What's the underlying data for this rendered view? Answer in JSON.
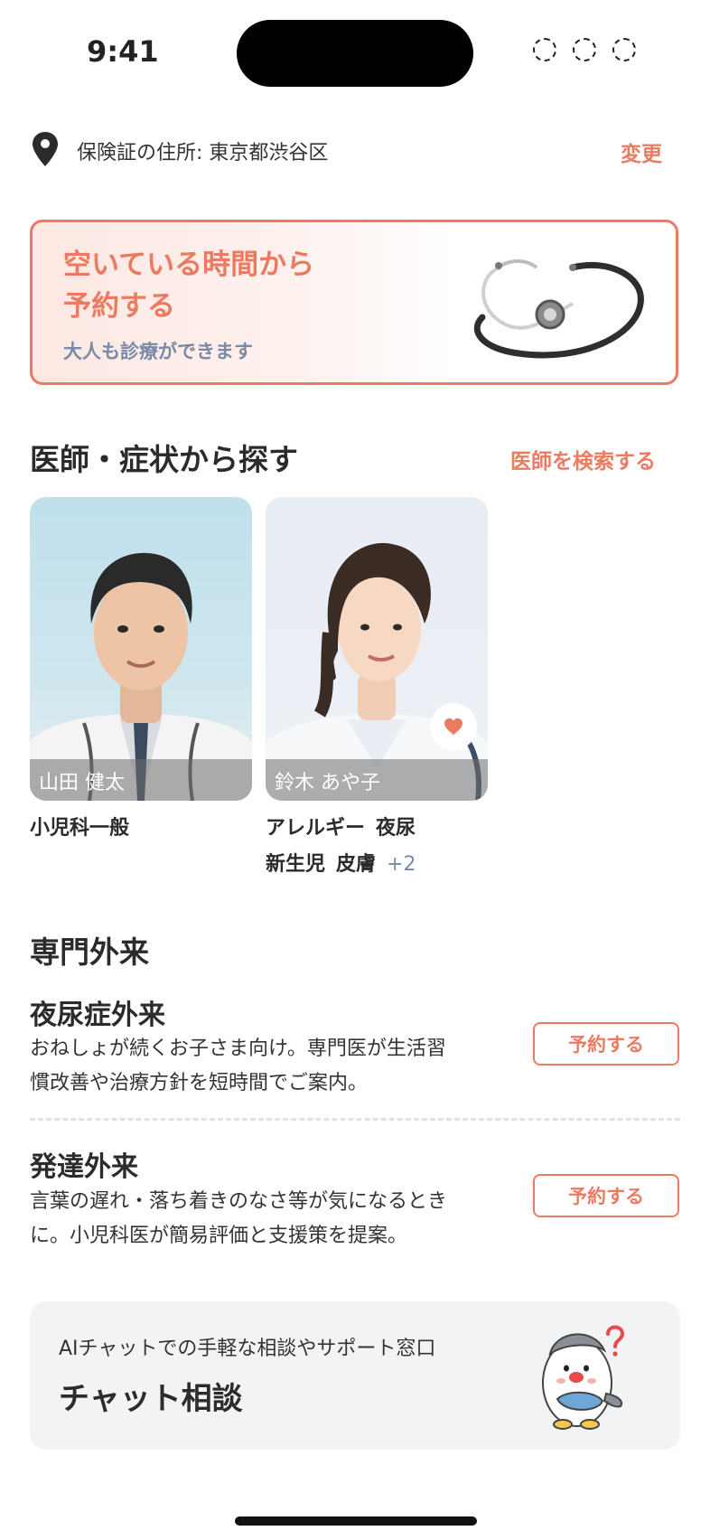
{
  "status_bar": {
    "time": "9:41"
  },
  "address": {
    "label": "保険証の住所: 東京都渋谷区",
    "change_label": "変更"
  },
  "banner": {
    "title_line1": "空いている時間から",
    "title_line2": "予約する",
    "subtitle": "大人も診療ができます"
  },
  "doctors_section": {
    "title": "医師・症状から探す",
    "search_link": "医師を検索する"
  },
  "doctors": [
    {
      "name": "山田 健太",
      "tags": [
        "小児科一般"
      ],
      "more": "",
      "favorite": false
    },
    {
      "name": "鈴木 あや子",
      "tags_line1": [
        "アレルギー",
        "夜尿"
      ],
      "tags_line2": [
        "新生児",
        "皮膚"
      ],
      "more": "+2",
      "favorite": true
    }
  ],
  "special_section": {
    "title": "専門外来",
    "items": [
      {
        "name": "夜尿症外来",
        "desc_line1": "おねしょが続くお子さま向け。専門医が生活習",
        "desc_line2": "慣改善や治療方針を短時間でご案内。",
        "button": "予約する"
      },
      {
        "name": "発達外来",
        "desc_line1": "言葉の遅れ・落ち着きのなさ等が気になるとき",
        "desc_line2": "に。小児科医が簡易評価と支援策を提案。",
        "button": "予約する"
      }
    ]
  },
  "chat": {
    "subtitle": "AIチャットでの手軽な相談やサポート窓口",
    "title": "チャット相談"
  },
  "colors": {
    "accent": "#ec7a61",
    "muted": "#7a8aa6",
    "card_bg": "#f2f3f4"
  }
}
